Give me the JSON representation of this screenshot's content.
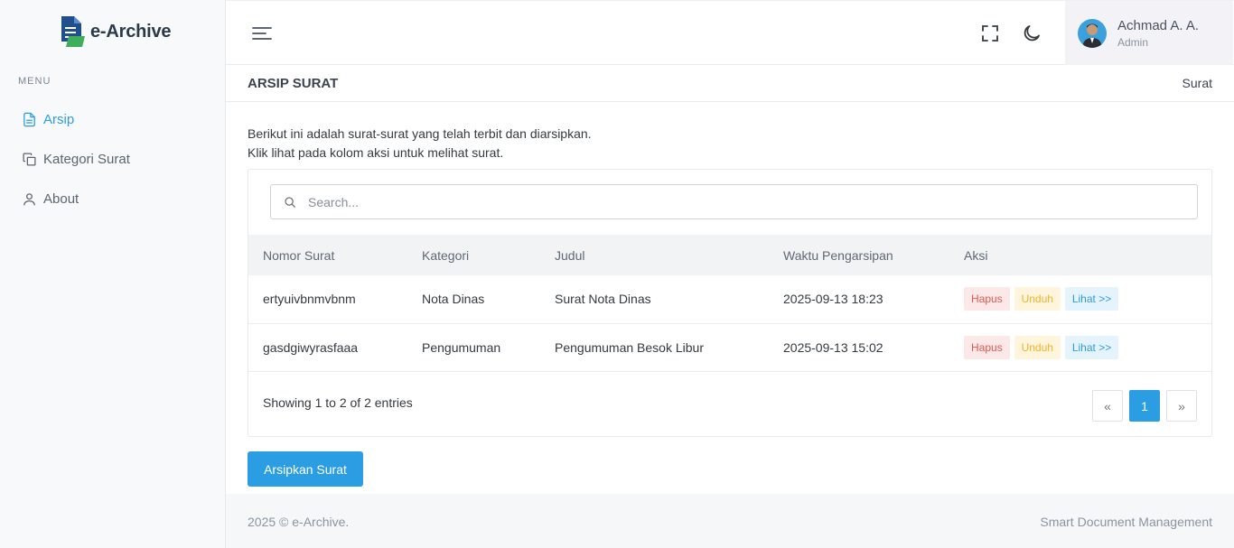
{
  "app": {
    "name": "e-Archive"
  },
  "sidebar": {
    "menu_title": "MENU",
    "items": [
      {
        "label": "Arsip",
        "icon": "file-text-icon",
        "active": true
      },
      {
        "label": "Kategori Surat",
        "icon": "copy-icon",
        "active": false
      },
      {
        "label": "About",
        "icon": "user-icon",
        "active": false
      }
    ]
  },
  "topbar": {
    "user": {
      "name": "Achmad A. A.",
      "role": "Admin"
    }
  },
  "page": {
    "title": "ARSIP SURAT",
    "breadcrumb": "Surat"
  },
  "intro": {
    "line1": "Berikut ini adalah surat-surat yang telah terbit dan diarsipkan.",
    "line2": "Klik lihat pada kolom aksi untuk melihat surat."
  },
  "search": {
    "placeholder": "Search...",
    "value": ""
  },
  "table": {
    "columns": [
      "Nomor Surat",
      "Kategori",
      "Judul",
      "Waktu Pengarsipan",
      "Aksi"
    ],
    "rows": [
      {
        "nomor": "ertyuivbnmvbnm",
        "kategori": "Nota Dinas",
        "judul": "Surat Nota Dinas",
        "waktu": "2025-09-13 18:23"
      },
      {
        "nomor": "gasdgiwyrasfaaa",
        "kategori": "Pengumuman",
        "judul": "Pengumuman Besok Libur",
        "waktu": "2025-09-13 15:02"
      }
    ],
    "actions": {
      "delete": "Hapus",
      "download": "Unduh",
      "view": "Lihat >>"
    }
  },
  "pagination": {
    "info": "Showing 1 to 2 of 2 entries",
    "prev": "«",
    "current": "1",
    "next": "»"
  },
  "archive_button": "Arsipkan Surat",
  "footer": {
    "left": "2025 © e-Archive.",
    "right": "Smart Document Management"
  },
  "colors": {
    "accent": "#2b9de3",
    "danger": "#e0594f",
    "warning": "#f1b32a",
    "sidebar_bg": "#f8f9fa"
  }
}
